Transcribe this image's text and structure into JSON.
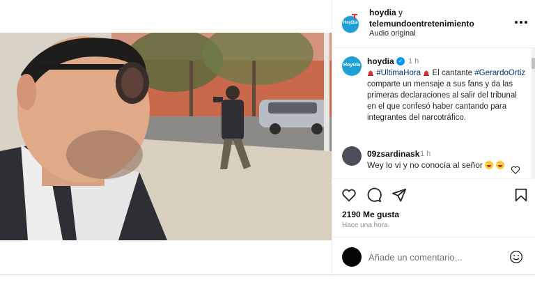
{
  "header": {
    "user1": "hoydia",
    "connector": "y",
    "user2": "telemundoentretenimiento",
    "audio": "Audio original",
    "avatar_text": "HoyDía"
  },
  "caption": {
    "username": "hoydia",
    "time": "1 h",
    "hashtag1": "#UltimaHora",
    "text1": "El cantante",
    "hashtag2": "#GerardoOrtiz",
    "text2": "comparte un mensaje a sus fans y da las primeras declaraciones al salir del tribunal en el que confesó haber cantando para integrantes del narcotráfico.",
    "avatar_text": "HoyDía"
  },
  "comments": [
    {
      "username": "09zsardinask",
      "time": "1 h",
      "text": "Wey lo vi y no conocía al señor"
    }
  ],
  "actions": {
    "likes": "2190 Me gusta",
    "ago": "Hace una hora"
  },
  "comment_box": {
    "placeholder": "Añade un comentario..."
  },
  "icons": {
    "more": "more-options-icon",
    "verified": "verified-badge-icon",
    "like": "heart-icon",
    "comment": "comment-icon",
    "share": "send-icon",
    "save": "bookmark-icon",
    "emoji": "emoji-icon",
    "sound": "speaker-icon"
  },
  "colors": {
    "brand_blue": "#1ea0d6",
    "verified": "#0095f6",
    "hashtag": "#00376b",
    "muted": "#8e8e8e",
    "siren_red": "#e0323b"
  }
}
